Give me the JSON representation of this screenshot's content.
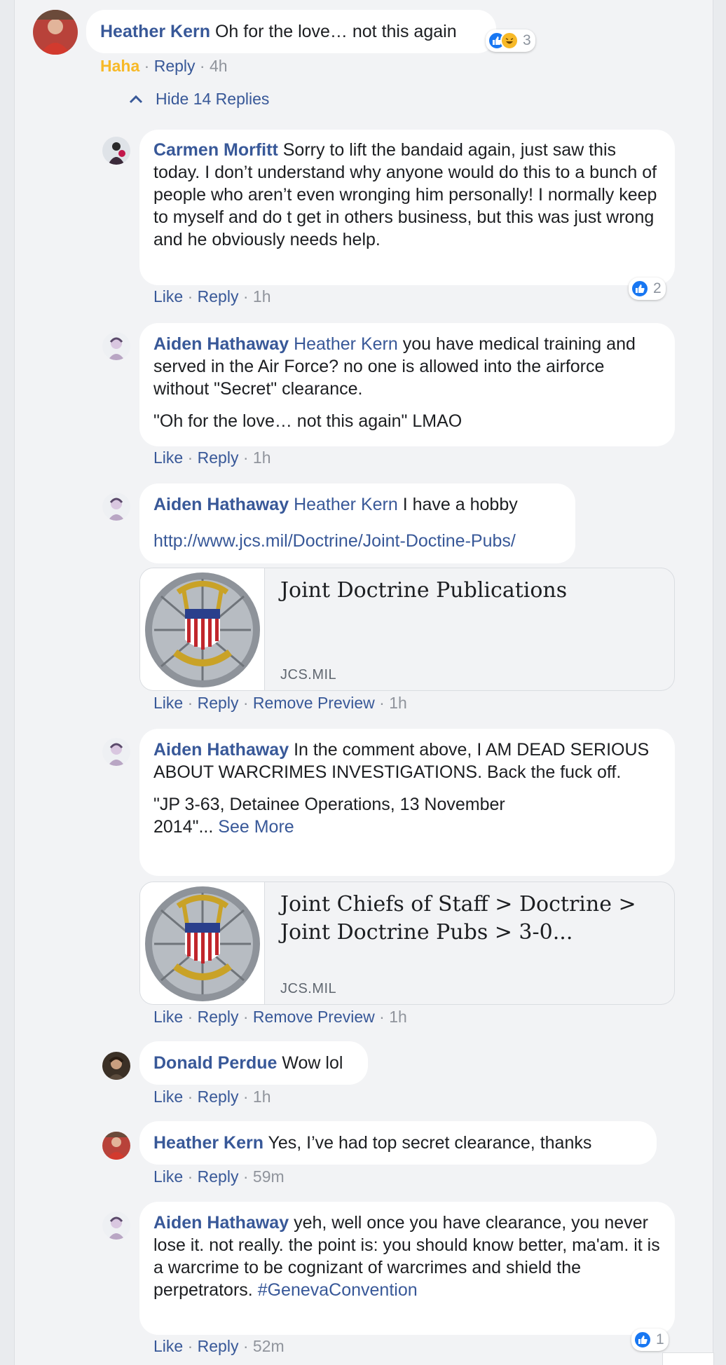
{
  "top_comment": {
    "author": "Heather Kern",
    "text": "Oh for the love… not this again",
    "reaction_count": "3",
    "reaction_label": "Haha",
    "reply_label": "Reply",
    "time": "4h"
  },
  "hide_replies": {
    "label": "Hide 14 Replies"
  },
  "sep": " · ",
  "replies": [
    {
      "author": "Carmen Morfitt",
      "text": "Sorry to lift the bandaid again, just saw this today. I don’t understand why anyone would do this to a bunch of people who aren’t even wronging him personally! I normally keep to myself and do t get in others business, but this was just wrong and he obviously needs help.",
      "like": "Like",
      "reply": "Reply",
      "time": "1h",
      "reaction_count": "2"
    },
    {
      "author": "Aiden Hathaway",
      "mention": "Heather Kern",
      "text": "you have medical training and served in the Air Force? no one is allowed into the airforce without \"Secret\" clearance.",
      "text2": "\"Oh for the love… not this again\" LMAO",
      "like": "Like",
      "reply": "Reply",
      "time": "1h"
    },
    {
      "author": "Aiden Hathaway",
      "mention": "Heather Kern",
      "text": "I have a hobby",
      "url": "http://www.jcs.mil/Doctrine/Joint-Doctine-Pubs/",
      "preview_title": "Joint Doctrine Publications",
      "preview_domain": "JCS.MIL",
      "like": "Like",
      "reply": "Reply",
      "remove_preview": "Remove Preview",
      "time": "1h"
    },
    {
      "author": "Aiden Hathaway",
      "text": "In the comment above, I AM DEAD SERIOUS ABOUT WARCRIMES INVESTIGATIONS. Back the fuck off.",
      "text2": "\"JP 3-63, Detainee Operations, 13 November 2014\"...",
      "see_more": "See More",
      "preview_title": "Joint Chiefs of Staff > Doctrine > Joint Doctrine Pubs > 3-0...",
      "preview_domain": "JCS.MIL",
      "like": "Like",
      "reply": "Reply",
      "remove_preview": "Remove Preview",
      "time": "1h"
    },
    {
      "author": "Donald Perdue",
      "text": "Wow lol",
      "like": "Like",
      "reply": "Reply",
      "time": "1h"
    },
    {
      "author": "Heather Kern",
      "text": "Yes, I’ve had top secret clearance, thanks",
      "like": "Like",
      "reply": "Reply",
      "time": "59m"
    },
    {
      "author": "Aiden Hathaway",
      "text": "yeh, well once you have clearance, you never lose it. not really. the point is: you should know better, ma'am. it is a warcrime to be cognizant of warcrimes and shield the perpetrators.",
      "hashtag": "#GenevaConvention",
      "like": "Like",
      "reply": "Reply",
      "time": "52m",
      "reaction_count": "1"
    }
  ],
  "colors": {
    "link": "#385898",
    "haha": "#f7b928",
    "like_blue": "#1877f2",
    "meta_gray": "#90949c"
  },
  "icons": [
    "chevron-up-icon",
    "like-reaction-icon",
    "haha-reaction-icon",
    "jcs-seal-logo"
  ]
}
